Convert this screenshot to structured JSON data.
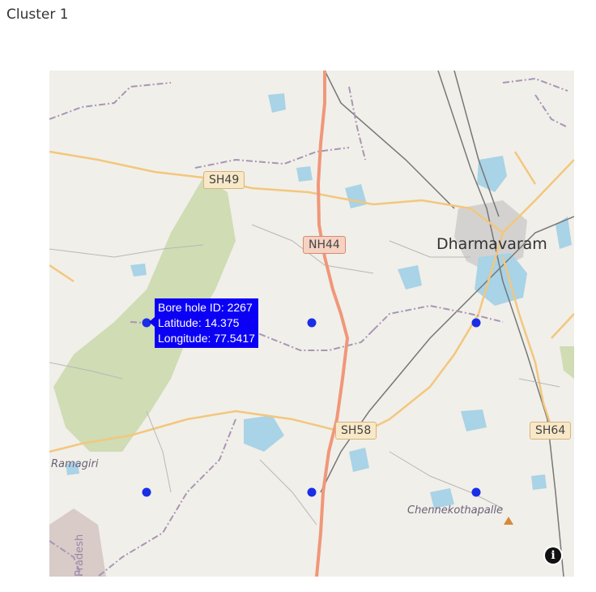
{
  "title": "Cluster 1",
  "map": {
    "roads": {
      "sh49": "SH49",
      "nh44": "NH44",
      "sh58": "SH58",
      "sh64": "SH64"
    },
    "places": {
      "dharmavaram": "Dharmavaram",
      "ramagiri": "Ramagiri",
      "chennekothapalle": "Chennekothapalle",
      "state": "Pradesh"
    },
    "markers": [
      {
        "id": "m1"
      },
      {
        "id": "m2"
      },
      {
        "id": "m3"
      },
      {
        "id": "m4"
      },
      {
        "id": "m5"
      },
      {
        "id": "m6"
      }
    ],
    "tooltip": {
      "line1": "Bore hole ID: 2267",
      "line2": "Latitude: 14.375",
      "line3": "Longitude: 77.5417"
    },
    "marker_color": "#1a2ee6",
    "tooltip_color": "#0b00f5",
    "info_icon": "info-icon"
  }
}
